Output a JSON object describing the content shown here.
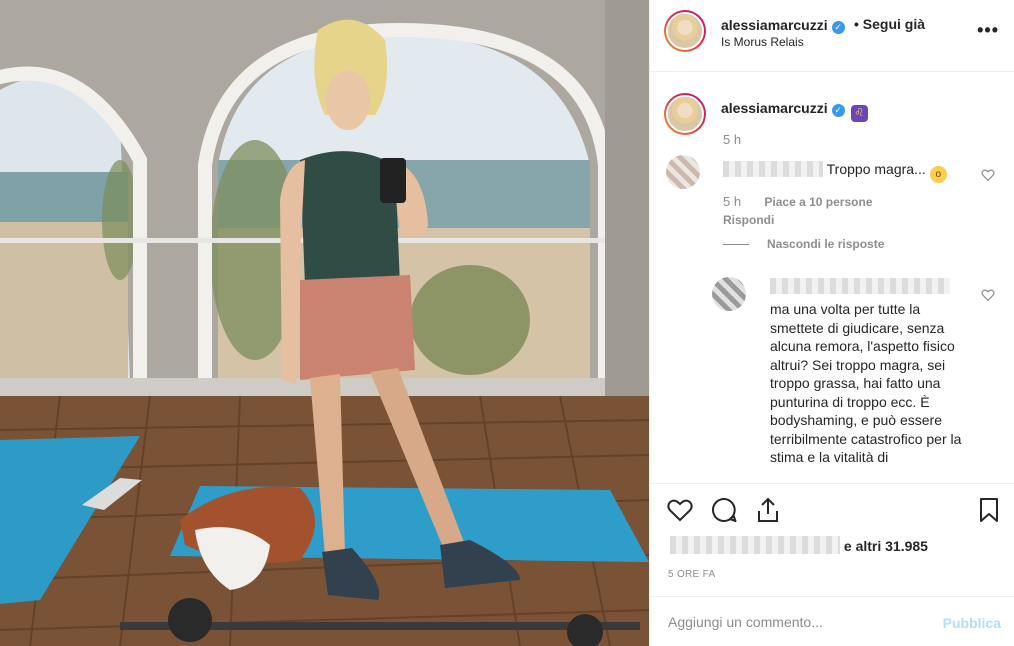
{
  "post": {
    "username": "alessiamarcuzzi",
    "follow_label": "• Segui già",
    "location": "Is Morus Relais"
  },
  "caption": {
    "username": "alessiamarcuzzi",
    "time": "5 h"
  },
  "comment1": {
    "text": "Troppo magra...",
    "time": "5 h",
    "likes": "Piace a 10 persone",
    "reply": "Rispondi",
    "hide_replies": "Nascondi le risposte"
  },
  "comment2": {
    "text": "ma una volta per tutte la smettete di giudicare, senza alcuna remora, l'aspetto fisico altrui? Sei troppo magra, sei troppo grassa, hai fatto una punturina di troppo ecc. È bodyshaming, e può essere terribilmente catastrofico per la stima e la vitalità di"
  },
  "footer": {
    "likes_suffix": "e altri 31.985",
    "post_time": "5 ORE FA",
    "comment_placeholder": "Aggiungi un commento...",
    "publish_label": "Pubblica"
  },
  "icons": {
    "verified": "verified-badge-icon",
    "more": "more-options-icon",
    "like": "heart-icon",
    "comment": "comment-bubble-icon",
    "share": "share-icon",
    "save": "bookmark-icon"
  },
  "colors": {
    "accent_blue": "#3897f0",
    "publish_disabled": "#b2dffc",
    "muted": "#8e8e8e"
  }
}
